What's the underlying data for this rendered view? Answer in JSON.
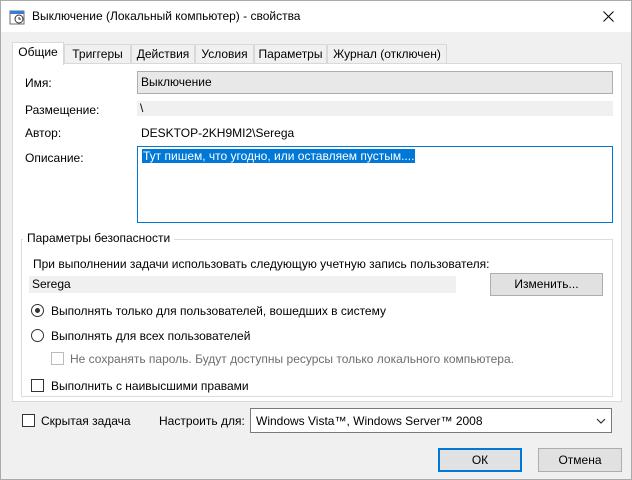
{
  "window": {
    "title": "Выключение (Локальный компьютер) - свойства"
  },
  "tabs": [
    {
      "label": "Общие",
      "active": true
    },
    {
      "label": "Триггеры",
      "active": false
    },
    {
      "label": "Действия",
      "active": false
    },
    {
      "label": "Условия",
      "active": false
    },
    {
      "label": "Параметры",
      "active": false
    },
    {
      "label": "Журнал (отключен)",
      "active": false
    }
  ],
  "general": {
    "name_label": "Имя:",
    "name_value": "Выключение",
    "location_label": "Размещение:",
    "location_value": "\\",
    "author_label": "Автор:",
    "author_value": "DESKTOP-2KH9MI2\\Serega",
    "description_label": "Описание:",
    "description_value": "Тут пишем, что угодно, или оставляем  пустым...."
  },
  "security": {
    "legend": "Параметры безопасности",
    "account_prompt": "При выполнении задачи использовать следующую учетную запись пользователя:",
    "account_value": "Serega",
    "change_button": "Изменить...",
    "radio_logged_on": "Выполнять только для пользователей, вошедших в систему",
    "radio_all_users": "Выполнять для всех пользователей",
    "no_store_password": "Не сохранять пароль. Будут доступны ресурсы только локального компьютера.",
    "highest_privileges": "Выполнить с наивысшими правами"
  },
  "bottom": {
    "hidden_task": "Скрытая задача",
    "configure_label": "Настроить для:",
    "configure_value": "Windows Vista™, Windows Server™ 2008"
  },
  "buttons": {
    "ok": "ОК",
    "cancel": "Отмена"
  },
  "colors": {
    "accent": "#0078d7",
    "window_bg": "#f0f0f0",
    "button_bg": "#e1e1e1"
  }
}
